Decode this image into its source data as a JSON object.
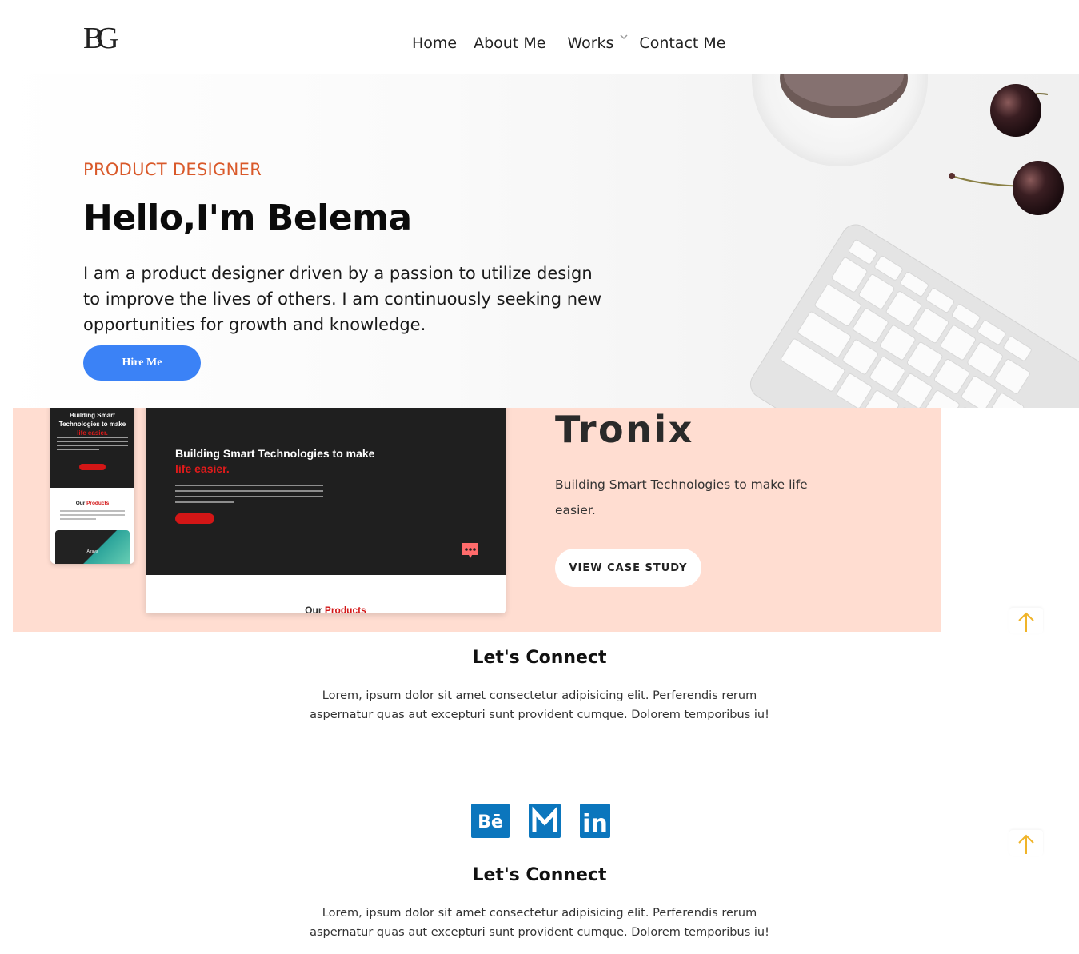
{
  "header": {
    "logo_text": "BG",
    "nav": {
      "home": "Home",
      "about": "About Me",
      "works": "Works",
      "contact": "Contact Me"
    }
  },
  "hero": {
    "eyebrow": "PRODUCT DESIGNER",
    "title": "Hello,I'm Belema",
    "text": "I am a product designer driven by a passion to utilize design to improve the lives of others. I am continuously seeking new opportunities for growth and knowledge.",
    "hire_label": "Hire Me"
  },
  "project": {
    "title": "Tronix",
    "description": "Building Smart Technologies to make life easier.",
    "button": "VIEW CASE STUDY",
    "mockup": {
      "heading_a": "Building Smart Technologies to make ",
      "heading_red": "life easier.",
      "phone_heading_a": "Building Smart Technologies to make ",
      "phone_heading_red": "life easier.",
      "our": "Our ",
      "products": "Products",
      "card_label": "Alrays"
    }
  },
  "connect": [
    {
      "title": "Let's Connect",
      "text": "Lorem, ipsum dolor sit amet consectetur adipisicing elit. Perferendis rerum aspernatur quas aut excepturi sunt provident cumque. Dolorem temporibus iu!"
    },
    {
      "title": "Let's Connect",
      "text": "Lorem, ipsum dolor sit amet consectetur adipisicing elit. Perferendis rerum aspernatur quas aut excepturi sunt provident cumque. Dolorem temporibus iu!"
    }
  ],
  "socials": [
    {
      "name": "behance-icon",
      "label": "Bē"
    },
    {
      "name": "gmail-icon",
      "label": "M"
    },
    {
      "name": "linkedin-icon",
      "label": "in"
    }
  ],
  "colors": {
    "accent_orange": "#d9592a",
    "button_blue": "#3b82f6",
    "project_bg": "#ffddd1",
    "social_blue": "#0b76bd",
    "arrow_yellow": "#f0b429"
  }
}
